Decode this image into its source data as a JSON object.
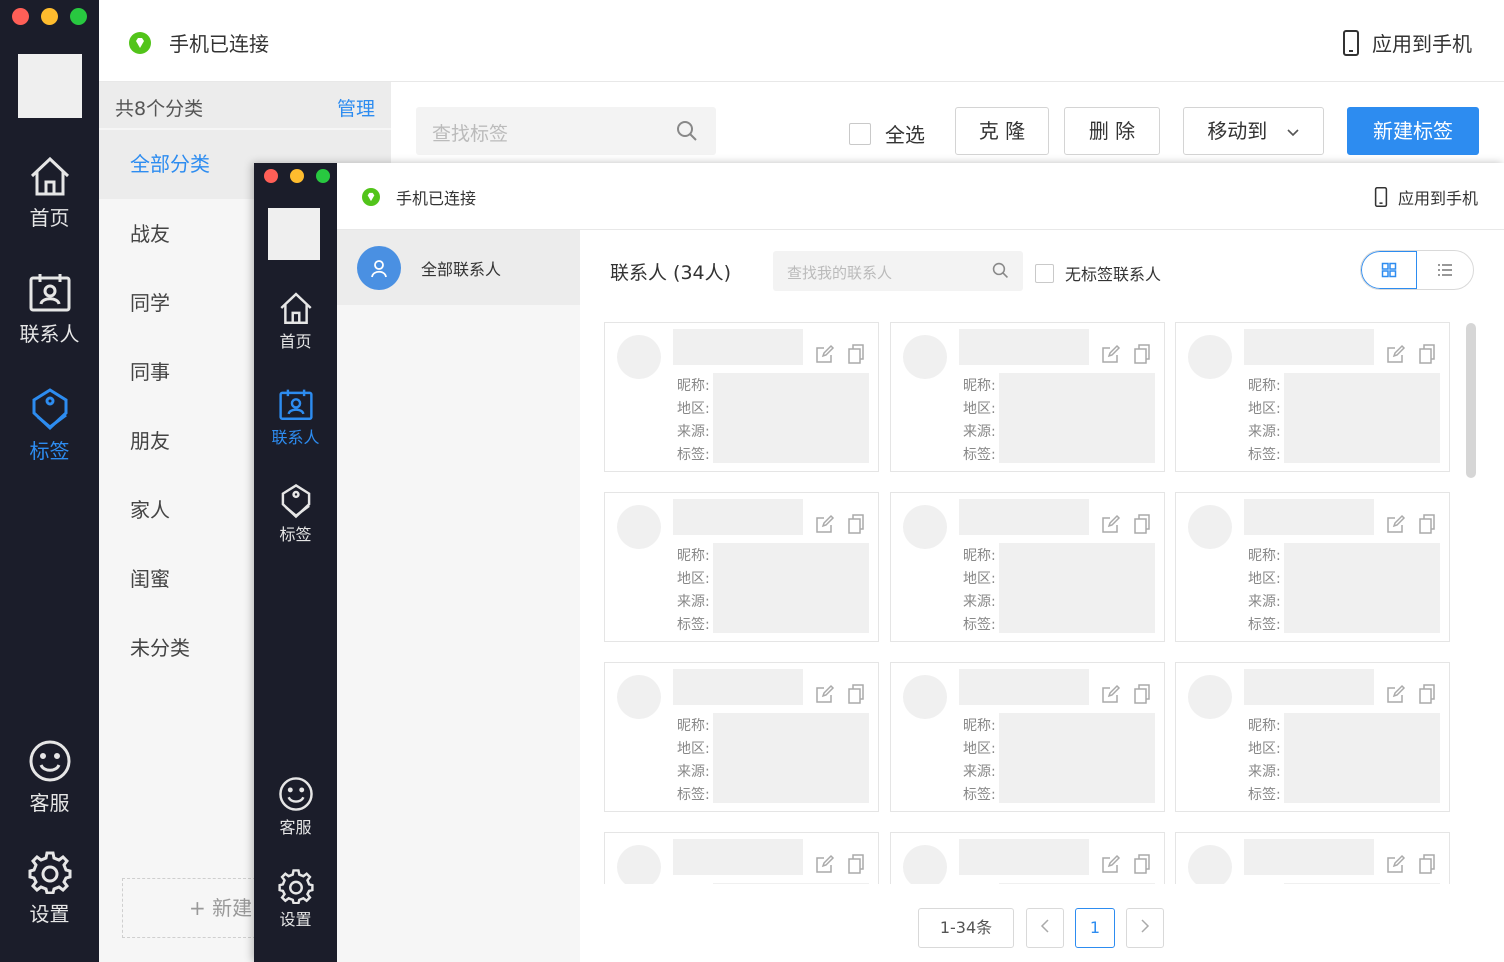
{
  "back_window": {
    "nav": [
      {
        "label": "首页",
        "icon": "home-icon"
      },
      {
        "label": "联系人",
        "icon": "contacts-icon"
      },
      {
        "label": "标签",
        "icon": "tag-icon",
        "active": true
      },
      {
        "label": "客服",
        "icon": "smiley-icon"
      },
      {
        "label": "设置",
        "icon": "gear-icon"
      }
    ],
    "status": "手机已连接",
    "apply_to_phone": "应用到手机",
    "category_count": "共8个分类",
    "manage": "管理",
    "categories": [
      "全部分类",
      "战友",
      "同学",
      "同事",
      "朋友",
      "家人",
      "闺蜜",
      "未分类"
    ],
    "new_category": "+ 新建",
    "search_placeholder": "查找标签",
    "select_all": "全选",
    "buttons": {
      "clone": "克 隆",
      "delete": "删 除",
      "move_to": "移动到",
      "new_tag": "新建标签"
    }
  },
  "front_window": {
    "nav": [
      {
        "label": "首页",
        "icon": "home-icon"
      },
      {
        "label": "联系人",
        "icon": "contacts-icon",
        "active": true
      },
      {
        "label": "标签",
        "icon": "tag-icon"
      },
      {
        "label": "客服",
        "icon": "smiley-icon"
      },
      {
        "label": "设置",
        "icon": "gear-icon"
      }
    ],
    "status": "手机已连接",
    "apply_to_phone": "应用到手机",
    "group": "全部联系人",
    "contacts_title": "联系人 (34人)",
    "search_placeholder": "查找我的联系人",
    "untagged": "无标签联系人",
    "card_fields": [
      "昵称:",
      "地区:",
      "来源:",
      "标签:"
    ],
    "pager": {
      "range": "1-34条",
      "current": "1"
    }
  },
  "colors": {
    "accent": "#2d8cf0",
    "sidebar": "#1b1d2a",
    "connected": "#52c41a"
  }
}
